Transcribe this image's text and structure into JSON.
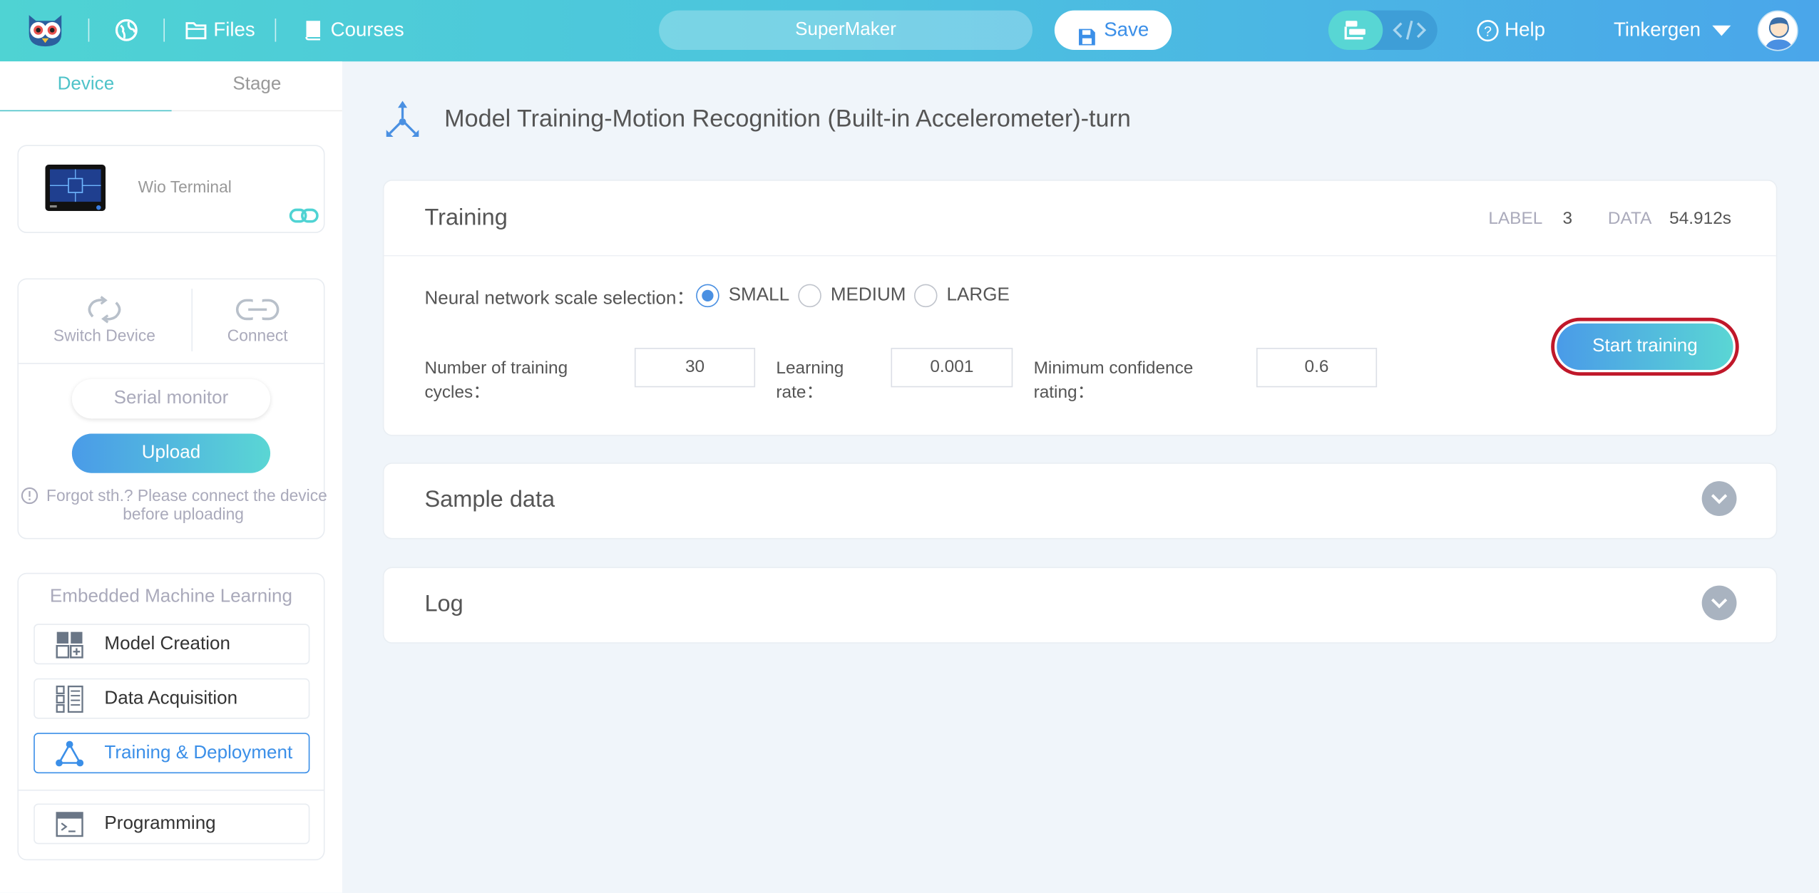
{
  "topbar": {
    "files_label": "Files",
    "courses_label": "Courses",
    "project_name": "SuperMaker",
    "save_label": "Save",
    "help_label": "Help",
    "user_name": "Tinkergen"
  },
  "sidebar": {
    "tabs": [
      {
        "label": "Device"
      },
      {
        "label": "Stage"
      }
    ],
    "device_name": "Wio Terminal",
    "switch_device_label": "Switch Device",
    "connect_label": "Connect",
    "serial_monitor_label": "Serial monitor",
    "upload_label": "Upload",
    "upload_hint": "Forgot sth.? Please connect the device before uploading",
    "ml_section_title": "Embedded Machine Learning",
    "menu": [
      {
        "label": "Model Creation"
      },
      {
        "label": "Data Acquisition"
      },
      {
        "label": "Training & Deployment"
      },
      {
        "label": "Programming"
      }
    ]
  },
  "main": {
    "page_title": "Model Training-Motion Recognition (Built-in Accelerometer)-turn",
    "training": {
      "title": "Training",
      "label_key": "LABEL",
      "label_value": "3",
      "data_key": "DATA",
      "data_value": "54.912s",
      "scale_label": "Neural network scale selection：",
      "scale_options": [
        {
          "label": "SMALL"
        },
        {
          "label": "MEDIUM"
        },
        {
          "label": "LARGE"
        }
      ],
      "scale_selected": "SMALL",
      "cycles_label_1": "Number of training",
      "cycles_label_2": "cycles：",
      "cycles_value": "30",
      "lr_label_1": "Learning",
      "lr_label_2": "rate：",
      "lr_value": "0.001",
      "conf_label_1": "Minimum confidence",
      "conf_label_2": "rating：",
      "conf_value": "0.6",
      "start_label": "Start training"
    },
    "sample_data_title": "Sample data",
    "log_title": "Log"
  },
  "colors": {
    "accent_blue": "#4a90e2",
    "accent_teal": "#4fd3d3",
    "highlight_red": "#c0182a",
    "active_menu": "#3b8fe8"
  }
}
